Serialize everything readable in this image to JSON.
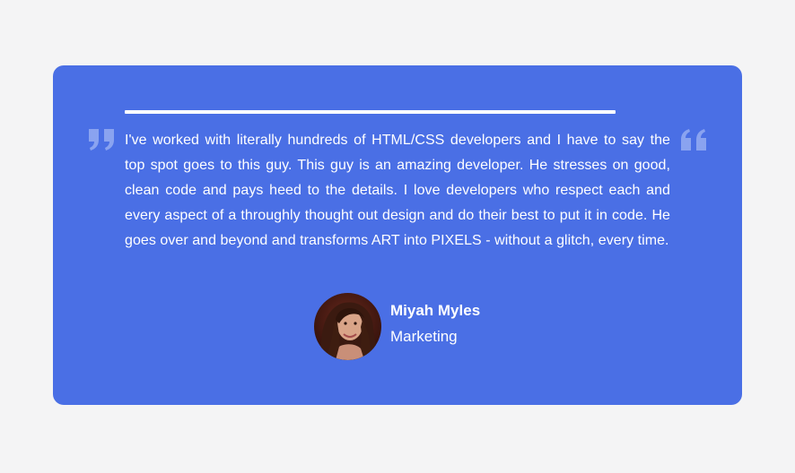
{
  "testimonial": {
    "quote": "I've worked with literally hundreds of HTML/CSS developers and I have to say the top spot goes to this guy. This guy is an amazing developer. He stresses on good, clean code and pays heed to the details. I love developers who respect each and every aspect of a throughly thought out design and do their best to put it in code. He goes over and beyond and transforms ART into PIXELS - without a glitch, every time.",
    "author_name": "Miyah Myles",
    "author_role": "Marketing"
  },
  "icons": {
    "left_quote": "quote-right-icon",
    "right_quote": "quote-left-icon",
    "avatar": "avatar-photo"
  },
  "colors": {
    "page_background": "#f4f4f5",
    "card_background": "#4a6fe5",
    "text": "#ffffff",
    "quote_icon": "#8aa3f0"
  }
}
